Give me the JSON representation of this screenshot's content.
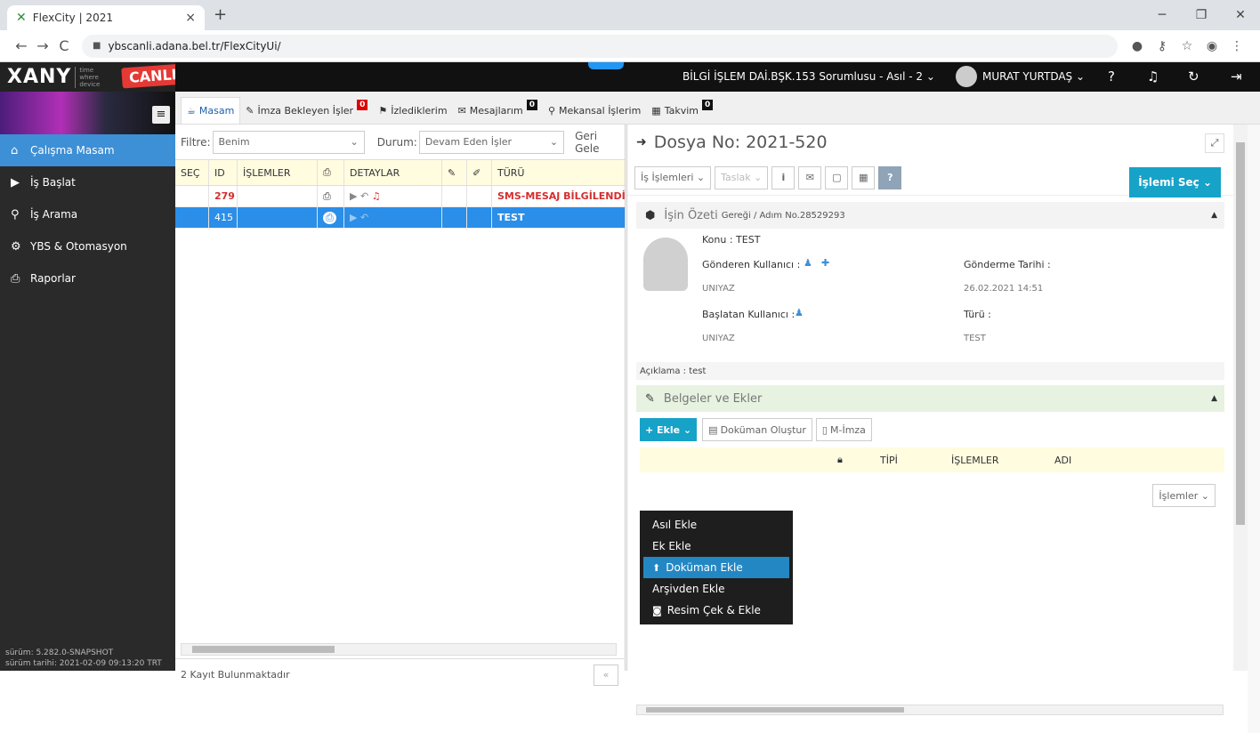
{
  "browser": {
    "tab_title": "FlexCity | 2021",
    "url": "ybscanli.adana.bel.tr/FlexCityUi/"
  },
  "app": {
    "logo": "XANY",
    "logo_small_1": "time",
    "logo_small_2": "where",
    "logo_small_3": "device",
    "env_badge": "CANLI",
    "unit": "BİLGİ İŞLEM DAİ.BŞK.153 Sorumlusu - Asıl - 2 ⌄",
    "user": "MURAT YURTDAŞ ⌄"
  },
  "sidebar": {
    "items": [
      {
        "label": "Çalışma Masam",
        "icon": "home-icon"
      },
      {
        "label": "İş Başlat",
        "icon": "play-icon"
      },
      {
        "label": "İş Arama",
        "icon": "search-icon"
      },
      {
        "label": "YBS & Otomasyon",
        "icon": "gear-icon"
      },
      {
        "label": "Raporlar",
        "icon": "print-icon"
      }
    ],
    "version_1": "sürüm: 5.282.0-SNAPSHOT",
    "version_2": "sürüm tarihi: 2021-02-09 09:13:20 TRT"
  },
  "worktabs": [
    {
      "label": "Masam"
    },
    {
      "label": "İmza Bekleyen İşler",
      "badge": "0"
    },
    {
      "label": "İzlediklerim"
    },
    {
      "label": "Mesajlarım",
      "badge": "0"
    },
    {
      "label": "Mekansal İşlerim"
    },
    {
      "label": "Takvim",
      "badge": "0"
    }
  ],
  "grid": {
    "filter_label": "Filtre:",
    "filter_value": "Benim",
    "status_label": "Durum:",
    "status_value": "Devam Eden İşler",
    "geri_label": "Geri Gele",
    "columns": [
      "SEÇ",
      "ID",
      "İŞLEMLER",
      "DETAYLAR",
      "TÜRÜ"
    ],
    "rows": [
      {
        "id": "279",
        "type": "SMS-MESAJ BİLGİLENDİRI"
      },
      {
        "id": "415",
        "type": "TEST"
      }
    ],
    "footer": "2 Kayıt Bulunmaktadır",
    "pager": "«"
  },
  "detail": {
    "title": "Dosya No: 2021-520",
    "tools": {
      "is_islemleri": "İş İşlemleri ⌄",
      "taslak": "Taslak ⌄",
      "islemi_sec": "İşlemi Seç ⌄"
    },
    "ozet": {
      "title": "İşin Özeti",
      "subtitle": "Gereği / Adım No.28529293",
      "konu": "Konu : TEST",
      "gonderen_label": "Gönderen Kullanıcı :",
      "gonderen_value": "UNIYAZ",
      "gonderme_label": "Gönderme Tarihi :",
      "gonderme_value": "26.02.2021 14:51",
      "baslatan_label": "Başlatan Kullanıcı :",
      "baslatan_value": "UNIYAZ",
      "turu_label": "Türü :",
      "turu_value": "TEST",
      "aciklama": "Açıklama : test"
    },
    "belgeler": {
      "title": "Belgeler ve Ekler",
      "ekle": "+ Ekle ⌄",
      "dokuman_olustur": "Doküman Oluştur",
      "m_imza": "M-İmza",
      "islemler": "İşlemler ⌄",
      "columns": [
        "TİPİ",
        "İŞLEMLER",
        "ADI"
      ],
      "menu": [
        {
          "label": "Asıl Ekle"
        },
        {
          "label": "Ek Ekle"
        },
        {
          "label": "Doküman Ekle",
          "icon": "upload-icon"
        },
        {
          "label": "Arşivden Ekle"
        },
        {
          "label": "Resim Çek & Ekle",
          "icon": "camera-icon"
        }
      ]
    }
  }
}
